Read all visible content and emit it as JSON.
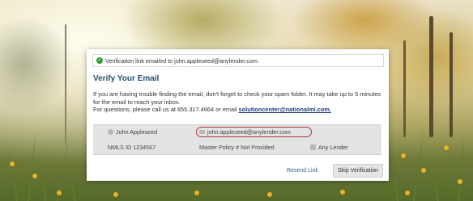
{
  "notice": {
    "icon": "check-circle-icon",
    "text": "Verification link emailed to john.appleseed@anylender.com."
  },
  "title": "Verify Your Email",
  "body": {
    "line1": "If you are having trouble finding the email, don't forget to check your spam folder. It may take up to 5 minutes for the email to reach your inbox.",
    "line2_prefix": "For questions, please call us at 855.317.4664 or email ",
    "line2_link": "solutioncenter@nationalmi.com."
  },
  "info": {
    "name": "John Appleseed",
    "email": "john.appleseed@anylender.com",
    "nmls": "NMLS ID 1234567",
    "master_policy": "Master Policy # Not Provided",
    "lender": "Any Lender"
  },
  "actions": {
    "resend": "Resend Link",
    "skip": "Skip Verification"
  },
  "colors": {
    "title": "#24506f",
    "highlight_oval": "#a8383a",
    "success": "#2e9b3a"
  }
}
